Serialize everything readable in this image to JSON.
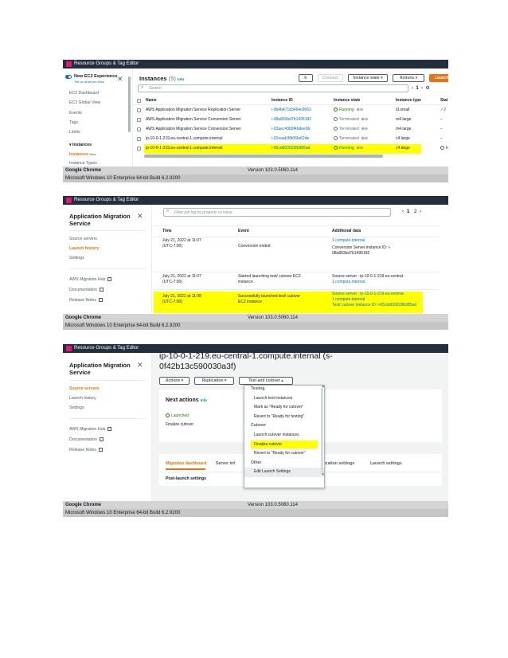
{
  "status_bar": {
    "browser": "Google Chrome",
    "version": "Version 103.0.5060.114",
    "os": "Microsoft Windows 10 Enterprise 64-bit Build 6.2.9200"
  },
  "top_bar": {
    "title": "Resource Groups & Tag Editor"
  },
  "ec2": {
    "new_experience": {
      "title": "New EC2 Experience",
      "subtitle": "Tell us what you think"
    },
    "nav": {
      "dashboard": "EC2 Dashboard",
      "global_view": "EC2 Global View",
      "events": "Events",
      "tags": "Tags",
      "limits": "Limits",
      "instances_section": "Instances",
      "instances": "Instances",
      "instances_badge": "New",
      "instance_types": "Instance Types"
    },
    "header": {
      "title": "Instances",
      "count": "(5)",
      "info": "Info",
      "connect": "Connect",
      "instance_state": "Instance state",
      "actions": "Actions",
      "launch": "Launch instances"
    },
    "search_placeholder": "Search",
    "page": "1",
    "columns": [
      "Name",
      "Instance ID",
      "Instance state",
      "Instance type",
      "Stat"
    ],
    "rows": [
      {
        "name": "AWS Application Migration Service Replication Server",
        "id": "i-0b4b471d3464c9663",
        "state": "Running",
        "type": "t3.small",
        "status": "2"
      },
      {
        "name": "AWS Application Migration Service Conversion Server",
        "id": "i-08a803bd7b1496182",
        "state": "Terminated",
        "type": "m4.large",
        "status": "–"
      },
      {
        "name": "AWS Application Migration Service Conversion Server",
        "id": "i-03aec43b9f4bdee6b",
        "state": "Terminated",
        "type": "m4.large",
        "status": "–"
      },
      {
        "name": "ip-10-0-1-219.eu-central-1.compute.internal",
        "id": "i-02eaab3fb06fa62de",
        "state": "Terminated",
        "type": "c4.large",
        "status": "–"
      },
      {
        "name": "ip-10-0-1-219.eu-central-1.compute.internal",
        "id": "i-05cdd02653fb985ad",
        "state": "Running",
        "type": "c4.large",
        "status": "Ir"
      }
    ]
  },
  "mgn_nav": {
    "title_line1": "Application Migration",
    "title_line2": "Service",
    "source_servers": "Source servers",
    "launch_history": "Launch history",
    "settings": "Settings",
    "migration_hub": "AWS Migration Hub",
    "documentation": "Documentation",
    "release_notes": "Release Notes"
  },
  "history": {
    "search_placeholder": "Filter job log by property or value",
    "pages": [
      "1",
      "2"
    ],
    "columns": [
      "Time",
      "Event",
      "Additional data"
    ],
    "rows": [
      {
        "time1": "July 21, 2022 at 11:07",
        "time2": "(UTC-7:00)",
        "event1": "Conversion ended",
        "event2": "",
        "data1": "1.compute.internal",
        "data2": "Conversion Server instance ID: i-",
        "data3": "08a803bd7b1496182"
      },
      {
        "time1": "July 21, 2022 at 11:07",
        "time2": "(UTC-7:00)",
        "event1": "Started launching test/ cutover EC2",
        "event2": "instance",
        "data1": "Source server : ip-10-0-1-219.eu-central-",
        "data2": "1.compute.internal",
        "data3": ""
      },
      {
        "time1": "July 21, 2022 at 11:08",
        "time2": "(UTC-7:00)",
        "event1": "Successfully launched test/ cutover",
        "event2": "EC2 instance",
        "data1": "Source server : ip-10-0-1-219.eu-central-",
        "data2": "1.compute.internal",
        "data3": "Test/ cutover instance ID: i-05cdd02653fb985ad"
      }
    ]
  },
  "server": {
    "heading_line1": "ip-10-0-1-219.eu-central-1.compute.internal (s-",
    "heading_line2": "0f42b13c590030a3f)",
    "actions": "Actions",
    "replication": "Replication",
    "test_cutover": "Test and cutover",
    "next_actions": "Next actions",
    "info": "Info",
    "launched": "Launched",
    "finalize": "Finalize cutover",
    "post_launch": "Post-launch settings",
    "tabs": [
      "Migration dashboard",
      "Server inf",
      "Replication settings",
      "Launch settings"
    ],
    "menu": {
      "testing": "Testing",
      "launch_test": "Launch test instances",
      "mark_ready": "Mark as \"Ready for cutover\"",
      "revert_testing": "Revert to \"Ready for testing\"",
      "cutover": "Cutover",
      "launch_cutover": "Launch cutover instances",
      "finalize": "Finalize cutover",
      "revert_cutover": "Revert to \"Ready for cutover\"",
      "other": "Other",
      "edit_launch": "Edit Launch Settings"
    }
  }
}
